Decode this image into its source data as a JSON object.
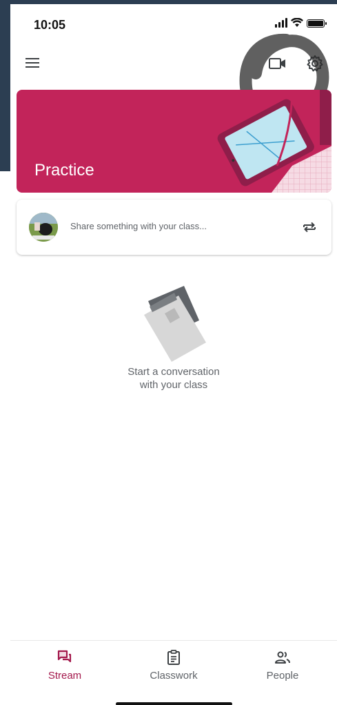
{
  "status_bar": {
    "time": "10:05",
    "icons": [
      "cellular-signal-icon",
      "wifi-icon",
      "battery-icon"
    ]
  },
  "app_bar": {
    "icons": [
      "menu-icon",
      "video-camera-icon",
      "settings-gear-icon"
    ]
  },
  "banner": {
    "title": "Practice",
    "color": "#c2245a"
  },
  "share_card": {
    "placeholder": "Share something with your class...",
    "icon": "repost-icon"
  },
  "empty_state": {
    "line1": "Start a conversation",
    "line2": "with your class",
    "icon": "conversation-paper-icon"
  },
  "bottom_nav": {
    "items": [
      {
        "label": "Stream",
        "icon": "stream-icon",
        "active": true
      },
      {
        "label": "Classwork",
        "icon": "classwork-clipboard-icon",
        "active": false
      },
      {
        "label": "People",
        "icon": "people-icon",
        "active": false
      }
    ]
  },
  "colors": {
    "accent": "#a3174b",
    "banner": "#c2245a",
    "text_secondary": "#5f6368"
  }
}
